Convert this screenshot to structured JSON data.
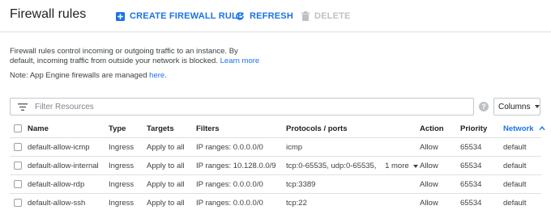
{
  "header": {
    "title": "Firewall rules",
    "create_label": "CREATE FIREWALL RULE",
    "refresh_label": "REFRESH",
    "delete_label": "DELETE"
  },
  "info": {
    "text": "Firewall rules control incoming or outgoing traffic to an instance. By default, incoming traffic from outside your network is blocked.",
    "link": "Learn more",
    "note_prefix": "Note: App Engine firewalls are managed",
    "note_link": "here",
    "note_suffix": "."
  },
  "filter": {
    "placeholder": "Filter Resources",
    "columns_label": "Columns",
    "help_glyph": "?"
  },
  "table": {
    "columns": [
      "Name",
      "Type",
      "Targets",
      "Filters",
      "Protocols / ports",
      "Action",
      "Priority",
      "Network"
    ],
    "rows": [
      {
        "name": "default-allow-icmp",
        "type": "Ingress",
        "targets": "Apply to all",
        "filters": "IP ranges: 0.0.0.0/0",
        "proto": "icmp",
        "more": "",
        "action": "Allow",
        "priority": "65534",
        "network": "default"
      },
      {
        "name": "default-allow-internal",
        "type": "Ingress",
        "targets": "Apply to all",
        "filters": "IP ranges: 10.128.0.0/9",
        "proto": "tcp:0-65535, udp:0-65535,",
        "more": "1 more",
        "action": "Allow",
        "priority": "65534",
        "network": "default"
      },
      {
        "name": "default-allow-rdp",
        "type": "Ingress",
        "targets": "Apply to all",
        "filters": "IP ranges: 0.0.0.0/0",
        "proto": "tcp:3389",
        "more": "",
        "action": "Allow",
        "priority": "65534",
        "network": "default"
      },
      {
        "name": "default-allow-ssh",
        "type": "Ingress",
        "targets": "Apply to all",
        "filters": "IP ranges: 0.0.0.0/0",
        "proto": "tcp:22",
        "more": "",
        "action": "Allow",
        "priority": "65534",
        "network": "default"
      }
    ]
  },
  "icons": {
    "create": "add-box-icon",
    "refresh": "refresh-icon",
    "delete": "trash-icon",
    "filter": "filter-list-icon",
    "help": "help-icon",
    "sort": "arrow-up-icon",
    "dropdown": "caret-down-icon"
  },
  "colors": {
    "accent": "#1a73e8",
    "disabled": "#bdc1c6",
    "divider": "#e0e0e0"
  }
}
